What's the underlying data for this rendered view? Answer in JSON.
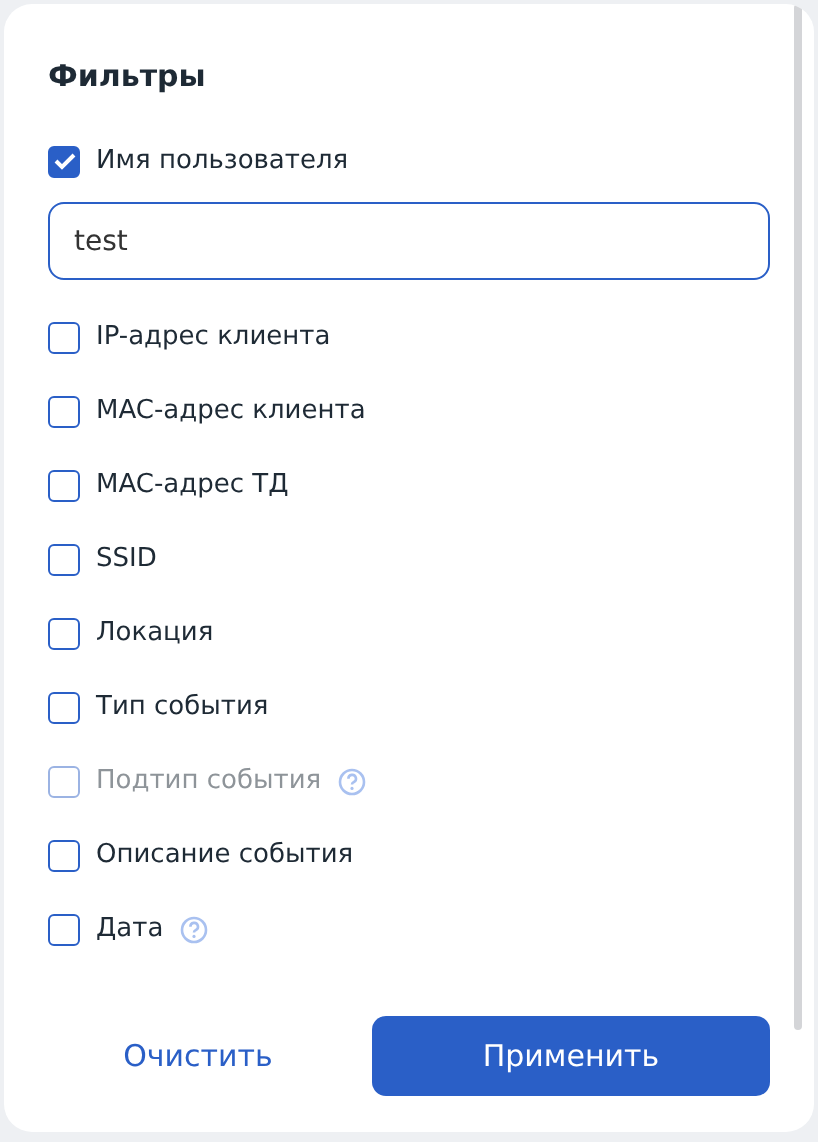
{
  "title": "Фильтры",
  "filters": [
    {
      "label": "Имя пользователя",
      "checked": true,
      "disabled": false,
      "value": "test"
    },
    {
      "label": "IP-адрес клиента",
      "checked": false,
      "disabled": false
    },
    {
      "label": "MAC-адрес клиента",
      "checked": false,
      "disabled": false
    },
    {
      "label": "MAC-адрес ТД",
      "checked": false,
      "disabled": false
    },
    {
      "label": "SSID",
      "checked": false,
      "disabled": false
    },
    {
      "label": "Локация",
      "checked": false,
      "disabled": false
    },
    {
      "label": "Тип события",
      "checked": false,
      "disabled": false
    },
    {
      "label": "Подтип события",
      "checked": false,
      "disabled": true,
      "help": true
    },
    {
      "label": "Описание события",
      "checked": false,
      "disabled": false
    },
    {
      "label": "Дата",
      "checked": false,
      "disabled": false,
      "help": true
    }
  ],
  "buttons": {
    "clear": "Очистить",
    "apply": "Применить"
  }
}
